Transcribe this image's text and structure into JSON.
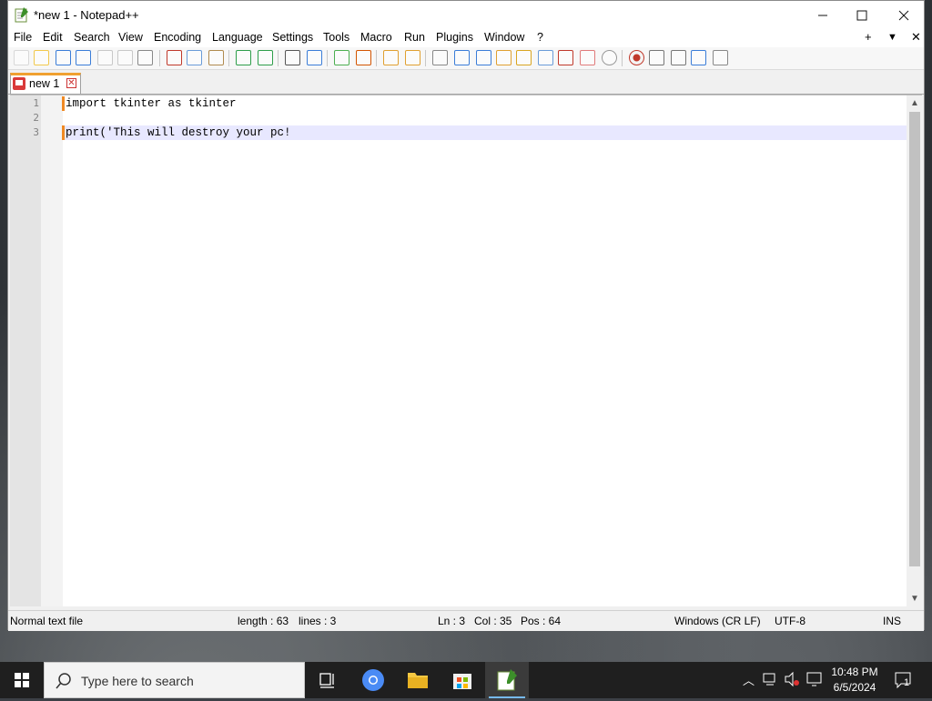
{
  "window": {
    "title": "*new 1 - Notepad++",
    "minimize_icon": "minimize-icon",
    "maximize_icon": "maximize-icon",
    "close_icon": "close-icon"
  },
  "menu": {
    "items": [
      "File",
      "Edit",
      "Search",
      "View",
      "Encoding",
      "Language",
      "Settings",
      "Tools",
      "Macro",
      "Run",
      "Plugins",
      "Window",
      "?"
    ],
    "right": [
      "+",
      "▼",
      "✕"
    ]
  },
  "toolbar": {
    "icons": [
      "new-file-icon",
      "open-file-icon",
      "save-icon",
      "save-all-icon",
      "close-icon",
      "close-all-icon",
      "print-icon",
      "cut-icon",
      "copy-icon",
      "paste-icon",
      "undo-icon",
      "redo-icon",
      "find-icon",
      "replace-icon",
      "zoom-in-icon",
      "zoom-out-icon",
      "sync-vertical-icon",
      "sync-horizontal-icon",
      "word-wrap-icon",
      "show-all-chars-icon",
      "indent-guide-icon",
      "user-defined-lang-icon",
      "doc-map-icon",
      "doc-list-icon",
      "function-list-icon",
      "folder-workspace-icon",
      "monitor-icon",
      "record-macro-icon",
      "stop-record-icon",
      "play-macro-icon",
      "run-macro-multiple-icon",
      "save-macro-icon"
    ]
  },
  "tab": {
    "label": "new 1",
    "icon": "unsaved-file-icon",
    "close": "✕"
  },
  "editor": {
    "lines": [
      {
        "num": "1",
        "text": "import tkinter as tkinter"
      },
      {
        "num": "2",
        "text": ""
      },
      {
        "num": "3",
        "text": "print('This will destroy your pc!"
      }
    ],
    "current_line": 3
  },
  "status": {
    "file_type": "Normal text file",
    "length": "length : 63",
    "lines": "lines : 3",
    "ln": "Ln : 3",
    "col": "Col : 35",
    "pos": "Pos : 64",
    "eol": "Windows (CR LF)",
    "encoding": "UTF-8",
    "mode": "INS"
  },
  "taskbar": {
    "search_placeholder": "Type here to search",
    "time": "10:48 PM",
    "date": "6/5/2024",
    "notifications": "1"
  },
  "colors": {
    "accent_tab": "#f0a030",
    "current_line": "#e8e8ff",
    "change_marker": "#f08a24",
    "taskbar": "#1f1f1f"
  }
}
